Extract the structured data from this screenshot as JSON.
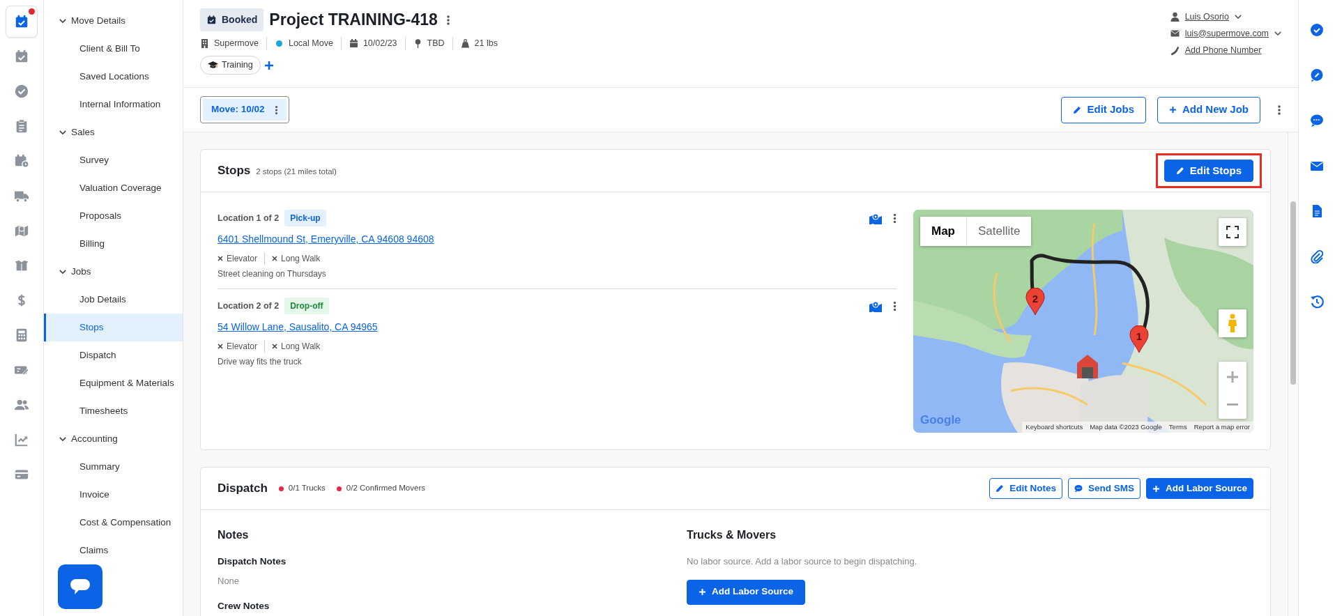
{
  "app_rail": [
    {
      "selected": true,
      "notification": true
    },
    {
      "selected": false,
      "notification": false
    },
    {
      "selected": false,
      "notification": false
    },
    {
      "selected": false,
      "notification": false
    },
    {
      "selected": false,
      "notification": false
    },
    {
      "selected": false,
      "notification": false
    },
    {
      "selected": false,
      "notification": false
    },
    {
      "selected": false,
      "notification": false
    },
    {
      "selected": false,
      "notification": false
    },
    {
      "selected": false,
      "notification": false
    },
    {
      "selected": false,
      "notification": false
    },
    {
      "selected": false,
      "notification": false
    },
    {
      "selected": false,
      "notification": false
    },
    {
      "selected": false,
      "notification": false
    }
  ],
  "sidebar": {
    "sections": [
      {
        "label": "Move Details",
        "expanded": true,
        "items": [
          {
            "label": "Client & Bill To",
            "selected": false
          },
          {
            "label": "Saved Locations",
            "selected": false
          },
          {
            "label": "Internal Information",
            "selected": false
          }
        ]
      },
      {
        "label": "Sales",
        "expanded": true,
        "items": [
          {
            "label": "Survey",
            "selected": false
          },
          {
            "label": "Valuation Coverage",
            "selected": false
          },
          {
            "label": "Proposals",
            "selected": false
          },
          {
            "label": "Billing",
            "selected": false
          }
        ]
      },
      {
        "label": "Jobs",
        "expanded": true,
        "items": [
          {
            "label": "Job Details",
            "selected": false
          },
          {
            "label": "Stops",
            "selected": true
          },
          {
            "label": "Dispatch",
            "selected": false
          },
          {
            "label": "Equipment & Materials",
            "selected": false
          },
          {
            "label": "Timesheets",
            "selected": false
          }
        ]
      },
      {
        "label": "Accounting",
        "expanded": true,
        "items": [
          {
            "label": "Summary",
            "selected": false
          },
          {
            "label": "Invoice",
            "selected": false
          },
          {
            "label": "Cost & Compensation",
            "selected": false
          },
          {
            "label": "Claims",
            "selected": false
          }
        ]
      }
    ]
  },
  "header": {
    "status": "Booked",
    "title": "Project TRAINING-418",
    "meta": [
      {
        "kind": "building",
        "text": "Supermove"
      },
      {
        "kind": "dot",
        "text": "Local Move"
      },
      {
        "kind": "calendar",
        "text": "10/02/23"
      },
      {
        "kind": "pin",
        "text": "TBD"
      },
      {
        "kind": "weight",
        "text": "21 lbs"
      }
    ],
    "tags": [
      {
        "label": "Training"
      }
    ],
    "contact": [
      {
        "kind": "person",
        "text": "Luis Osorio",
        "dropdown": true
      },
      {
        "kind": "email",
        "text": "luis@supermove.com",
        "dropdown": true
      },
      {
        "kind": "phone",
        "text": "Add Phone Number",
        "dropdown": false
      }
    ]
  },
  "job_tabs": [
    {
      "label": "Move: 10/02",
      "selected": true
    }
  ],
  "job_actions": [
    {
      "kind": "edit",
      "label": "Edit Jobs"
    },
    {
      "kind": "add",
      "label": "Add New Job"
    }
  ],
  "stops": {
    "title": "Stops",
    "summary": "2 stops (21 miles total)",
    "edit_button": {
      "label": "Edit Stops",
      "highlighted": true
    },
    "locations": [
      {
        "label": "Location 1 of 2",
        "type": "Pick-up",
        "kind": "pickup",
        "address": "6401 Shellmound St, Emeryville, CA 94608 94608",
        "attributes": [
          {
            "label": "Elevator",
            "available": false
          },
          {
            "label": "Long Walk",
            "available": false
          }
        ],
        "note": "Street cleaning on Thursdays"
      },
      {
        "label": "Location 2 of 2",
        "type": "Drop-off",
        "kind": "dropoff",
        "address": "54 Willow Lane, Sausalito, CA 94965",
        "attributes": [
          {
            "label": "Elevator",
            "available": false
          },
          {
            "label": "Long Walk",
            "available": false
          }
        ],
        "note": "Drive way fits the truck"
      }
    ],
    "map": {
      "modes": [
        {
          "label": "Map",
          "selected": true
        },
        {
          "label": "Satellite",
          "selected": false
        }
      ],
      "markers": [
        {
          "label": "2"
        },
        {
          "label": "1"
        }
      ],
      "logo": "Google",
      "attribution": [
        "Keyboard shortcuts",
        "Map data ©2023 Google",
        "Terms",
        "Report a map error"
      ]
    }
  },
  "dispatch": {
    "title": "Dispatch",
    "stats": [
      {
        "text": "0/1 Trucks",
        "complete": false
      },
      {
        "text": "0/2 Confirmed Movers",
        "complete": false
      }
    ],
    "actions": [
      {
        "kind": "edit",
        "label": "Edit Notes"
      },
      {
        "kind": "sms",
        "label": "Send SMS"
      },
      {
        "kind": "add",
        "label": "Add Labor Source"
      }
    ],
    "notes": {
      "heading": "Notes",
      "fields": [
        {
          "label": "Dispatch Notes",
          "value": "None"
        },
        {
          "label": "Crew Notes"
        }
      ]
    },
    "crew": {
      "heading": "Trucks & Movers",
      "empty": "No labor source. Add a labor source to begin dispatching.",
      "button": "Add Labor Source"
    }
  }
}
